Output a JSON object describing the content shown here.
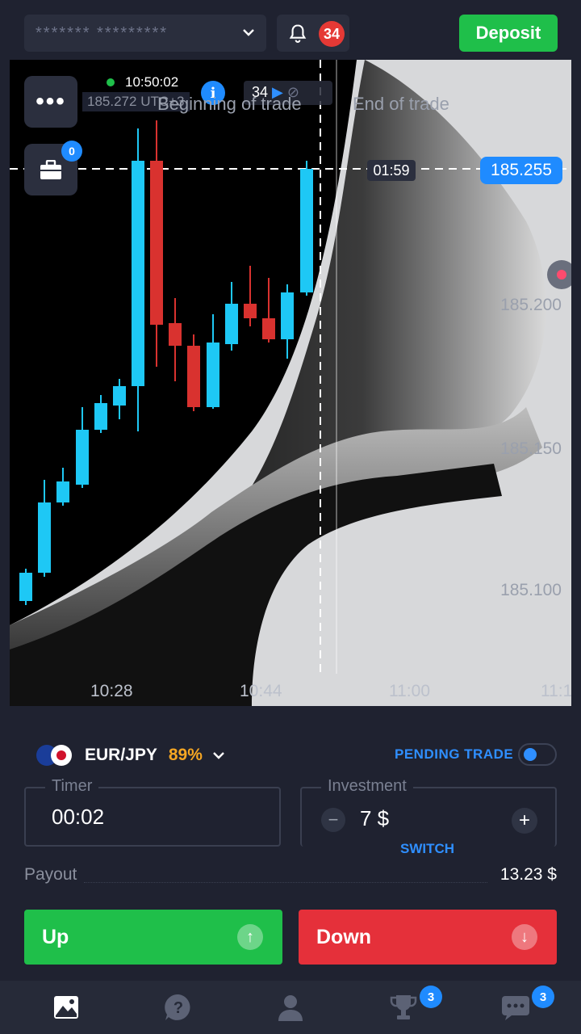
{
  "header": {
    "account_mask": "******* *********",
    "notifications_count": "34",
    "deposit_label": "Deposit"
  },
  "chart": {
    "time": "10:50:02",
    "utc_label": "UTC+3",
    "ghost_price": "185.272",
    "timer_tag": "34",
    "beginning_label": "Beginning of trade",
    "end_label": "End of trade",
    "countdown": "01:59",
    "current_price": "185.255",
    "briefcase_badge": "0",
    "menu_label": "•••",
    "y_labels": [
      "185.200",
      "185.150",
      "185.100"
    ],
    "x_labels": [
      "10:28",
      "10:44",
      "11:00",
      "11:1"
    ]
  },
  "chart_data": {
    "type": "candlestick",
    "y_axis_labels": [
      "185.255",
      "185.200",
      "185.150",
      "185.100"
    ],
    "x_axis_labels": [
      "10:28",
      "10:44",
      "11:00",
      "11:1"
    ],
    "colors": {
      "up": "#1ec8f5",
      "down": "#d9322f"
    }
  },
  "controls": {
    "pair": "EUR/JPY",
    "payout_pct": "89%",
    "pending_label": "PENDING TRADE",
    "timer_legend": "Timer",
    "timer_value": "00:02",
    "investment_legend": "Investment",
    "investment_value": "7 $",
    "switch_label": "SWITCH",
    "payout_label": "Payout",
    "payout_value": "13.23 $",
    "up_label": "Up",
    "down_label": "Down"
  },
  "nav": {
    "tournaments_badge": "3",
    "chat_badge": "3"
  }
}
